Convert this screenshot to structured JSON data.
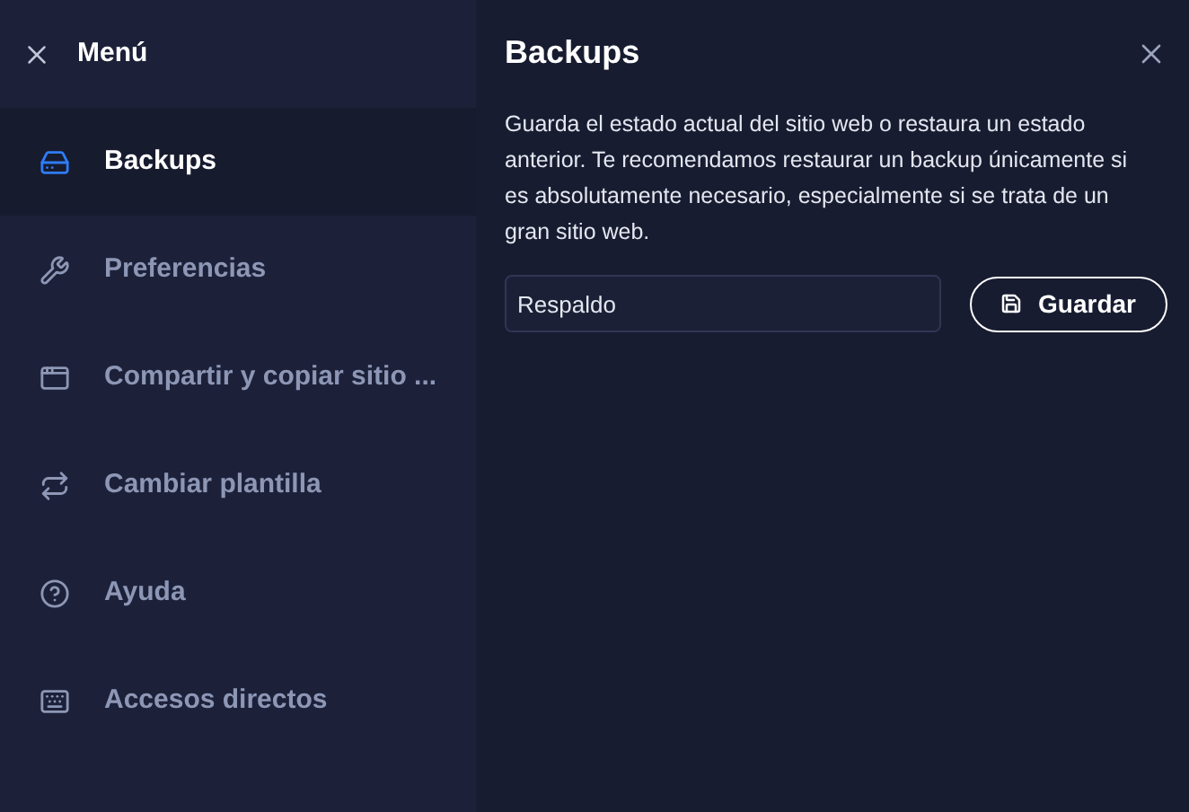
{
  "menu": {
    "title": "Menú",
    "items": [
      {
        "label": "Backups",
        "selected": true
      },
      {
        "label": "Preferencias",
        "selected": false
      },
      {
        "label": "Compartir y copiar sitio ...",
        "selected": false
      },
      {
        "label": "Cambiar plantilla",
        "selected": false
      },
      {
        "label": "Ayuda",
        "selected": false
      },
      {
        "label": "Accesos directos",
        "selected": false
      }
    ]
  },
  "panel": {
    "title": "Backups",
    "description": "Guarda el estado actual del sitio web o restaura un estado anterior. Te recomendamos restaurar un backup únicamente si es absolutamente necesario, especialmente si se trata de un gran sitio web.",
    "name_field": {
      "value": "Respaldo"
    },
    "save_button": "Guardar"
  }
}
